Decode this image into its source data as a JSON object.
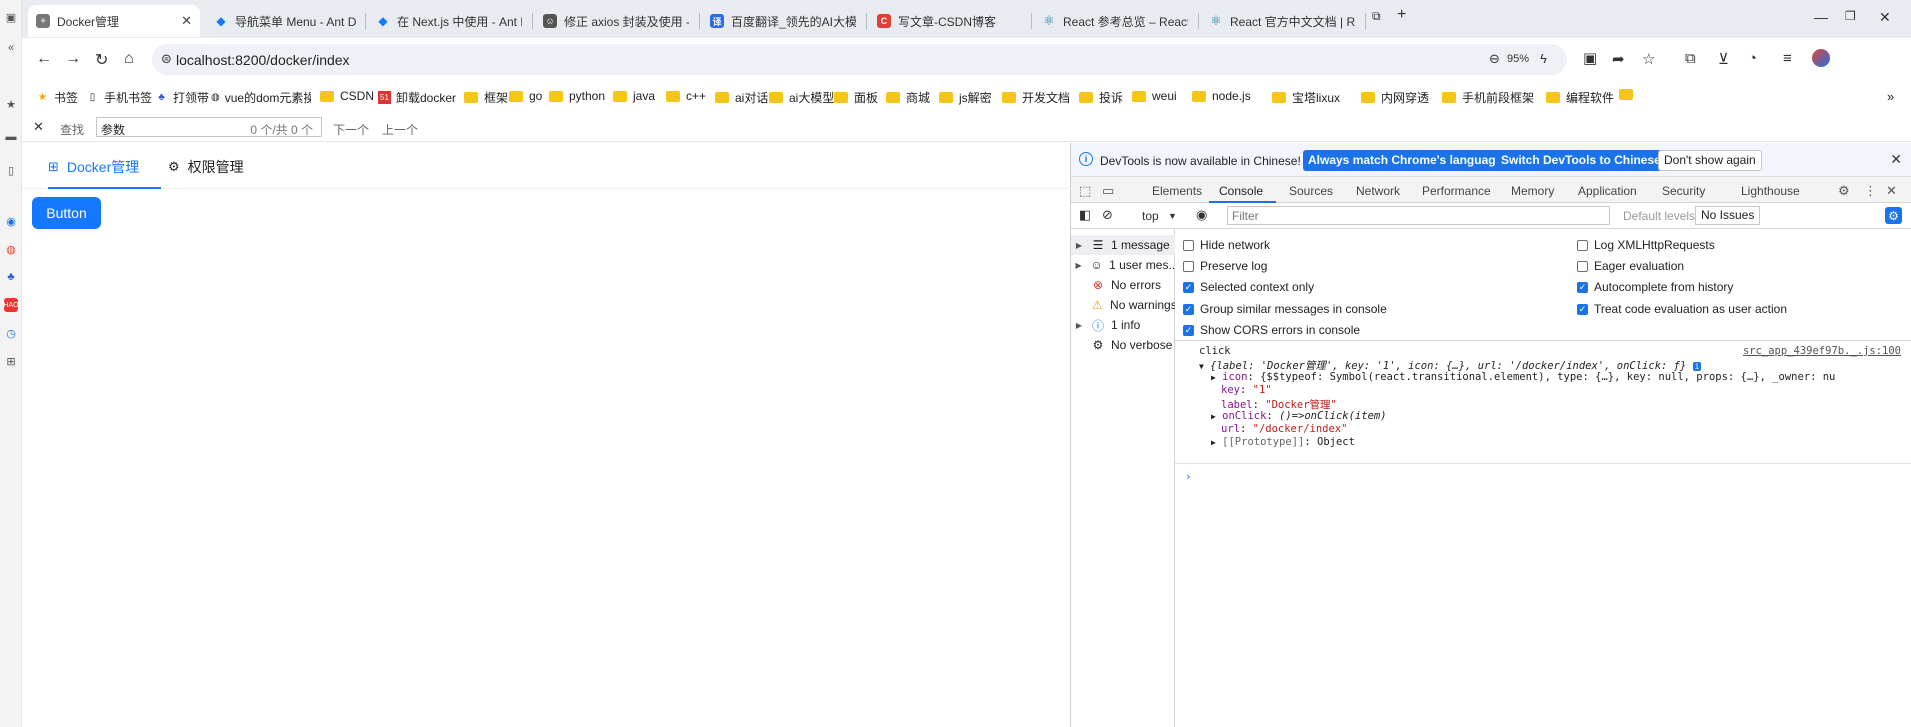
{
  "browser": {
    "tabs": [
      {
        "title": "Docker管理",
        "favicon": "docker-favicon",
        "color": "#777777",
        "fav_text": "✳"
      },
      {
        "title": "导航菜单 Menu - Ant Design",
        "favicon": "antd-favicon",
        "color": "#1677ff",
        "fav_text": "◆"
      },
      {
        "title": "在 Next.js 中使用 - Ant Design",
        "favicon": "antd-favicon",
        "color": "#1677ff",
        "fav_text": "◆"
      },
      {
        "title": "修正 axios 封装及使用 - 豆包",
        "favicon": "doubao-favicon",
        "color": "#444444",
        "fav_text": "☺"
      },
      {
        "title": "百度翻译_领先的AI大模型翻译",
        "favicon": "fanyi-favicon",
        "color": "#2b6cea",
        "fav_text": "译"
      },
      {
        "title": "写文章-CSDN博客",
        "favicon": "csdn-favicon",
        "color": "#e33e33",
        "fav_text": "C"
      },
      {
        "title": "React 参考总览 – React 中文文档",
        "favicon": "react-favicon",
        "color": "#087ea4",
        "fav_text": "⚛"
      },
      {
        "title": "React 官方中文文档 | React 中文文档",
        "favicon": "react-favicon",
        "color": "#087ea4",
        "fav_text": "⚛"
      }
    ],
    "new_tab_label": "+",
    "url": "localhost:8200/docker/index",
    "zoom": "95%",
    "bookmarks": [
      {
        "label": "书签",
        "icon": "star-icon"
      },
      {
        "label": "手机书签",
        "icon": "phone-icon"
      },
      {
        "label": "打领带",
        "icon": "baidu-icon"
      },
      {
        "label": "vue的dom元素操作",
        "icon": "globe-icon"
      },
      {
        "label": "CSDN",
        "icon": "folder-icon"
      },
      {
        "label": "卸载docker",
        "icon": "51-icon"
      },
      {
        "label": "框架",
        "icon": "folder-icon"
      },
      {
        "label": "go",
        "icon": "folder-icon"
      },
      {
        "label": "python",
        "icon": "folder-icon"
      },
      {
        "label": "java",
        "icon": "folder-icon"
      },
      {
        "label": "c++",
        "icon": "folder-icon"
      },
      {
        "label": "ai对话",
        "icon": "folder-icon"
      },
      {
        "label": "ai大模型",
        "icon": "folder-icon"
      },
      {
        "label": "面板",
        "icon": "folder-icon"
      },
      {
        "label": "商城",
        "icon": "folder-icon"
      },
      {
        "label": "js解密",
        "icon": "folder-icon"
      },
      {
        "label": "开发文档",
        "icon": "folder-icon"
      },
      {
        "label": "投诉",
        "icon": "folder-icon"
      },
      {
        "label": "weui",
        "icon": "folder-icon"
      },
      {
        "label": "node.js",
        "icon": "folder-icon"
      },
      {
        "label": "宝塔lixux",
        "icon": "folder-icon"
      },
      {
        "label": "内网穿透",
        "icon": "folder-icon"
      },
      {
        "label": "手机前段框架",
        "icon": "folder-icon"
      },
      {
        "label": "编程软件",
        "icon": "folder-icon"
      }
    ],
    "find": {
      "label": "查找",
      "query": "参数",
      "count": "0 个/共 0 个",
      "next": "下一个",
      "prev": "上一个"
    }
  },
  "page": {
    "menu": [
      {
        "label": "Docker管理",
        "icon": "appstore-icon",
        "selected": true
      },
      {
        "label": "权限管理",
        "icon": "setting-icon",
        "selected": false
      }
    ],
    "button_label": "Button"
  },
  "devtools": {
    "infobar": {
      "message": "DevTools is now available in Chinese!",
      "match_btn": "Always match Chrome's language",
      "switch_btn": "Switch DevTools to Chinese",
      "dismiss_btn": "Don't show again"
    },
    "tabs": [
      "Elements",
      "Console",
      "Sources",
      "Network",
      "Performance",
      "Memory",
      "Application",
      "Security",
      "Lighthouse"
    ],
    "active_tab": "Console",
    "toolbar": {
      "context": "top",
      "filter_placeholder": "Filter",
      "levels": "Default levels",
      "issues": "No Issues"
    },
    "sidebar": [
      {
        "label": "1 message",
        "icon": "list-icon",
        "expandable": true
      },
      {
        "label": "1 user mes...",
        "icon": "user-icon",
        "expandable": true
      },
      {
        "label": "No errors",
        "icon": "error-icon",
        "expandable": false
      },
      {
        "label": "No warnings",
        "icon": "warning-icon",
        "expandable": false
      },
      {
        "label": "1 info",
        "icon": "info-icon",
        "expandable": true
      },
      {
        "label": "No verbose",
        "icon": "verbose-icon",
        "expandable": false
      }
    ],
    "settings_left": [
      {
        "label": "Hide network",
        "checked": false
      },
      {
        "label": "Preserve log",
        "checked": false
      },
      {
        "label": "Selected context only",
        "checked": true
      },
      {
        "label": "Group similar messages in console",
        "checked": true
      },
      {
        "label": "Show CORS errors in console",
        "checked": true
      }
    ],
    "settings_right": [
      {
        "label": "Log XMLHttpRequests",
        "checked": false
      },
      {
        "label": "Eager evaluation",
        "checked": false
      },
      {
        "label": "Autocomplete from history",
        "checked": true
      },
      {
        "label": "Treat code evaluation as user action",
        "checked": true
      }
    ],
    "console": {
      "log_text": "click",
      "source": "src_app_439ef97b._.js:100",
      "summary": "{label: 'Docker管理', key: '1', icon: {…}, url: '/docker/index', onClick: ƒ}",
      "props": [
        {
          "key": "icon",
          "value": "{$$typeof: Symbol(react.transitional.element), type: {…}, key: null, props: {…}, _owner: nu"
        },
        {
          "key": "key",
          "value": "\"1\""
        },
        {
          "key": "label",
          "value": "\"Docker管理\""
        },
        {
          "key": "onClick",
          "value": "()=>onClick(item)"
        },
        {
          "key": "url",
          "value": "\"/docker/index\""
        },
        {
          "key": "[[Prototype]]",
          "value": "Object"
        }
      ],
      "prompt": "›"
    }
  }
}
